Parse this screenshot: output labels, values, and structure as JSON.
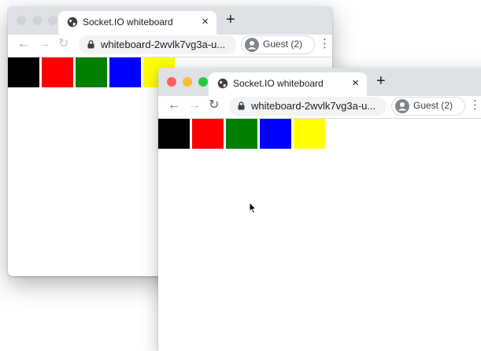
{
  "browser": {
    "tab_title": "Socket.IO whiteboard",
    "tab_close": "×",
    "new_tab": "+",
    "url": "whiteboard-2wvlk7vg3a-u...",
    "profile_label": "Guest (2)",
    "menu_glyph": "⋮",
    "back_glyph": "←",
    "forward_glyph": "→",
    "reload_glyph": "↻"
  },
  "traffic_lights": {
    "close": "#ff5f57",
    "minimize": "#febc2e",
    "zoom": "#28c840",
    "inactive": "#d0d2d6"
  },
  "palette": [
    {
      "name": "black",
      "color": "#000000"
    },
    {
      "name": "red",
      "color": "#ff0000"
    },
    {
      "name": "green",
      "color": "#008000"
    },
    {
      "name": "blue",
      "color": "#0000ff"
    },
    {
      "name": "yellow",
      "color": "#ffff00"
    }
  ]
}
